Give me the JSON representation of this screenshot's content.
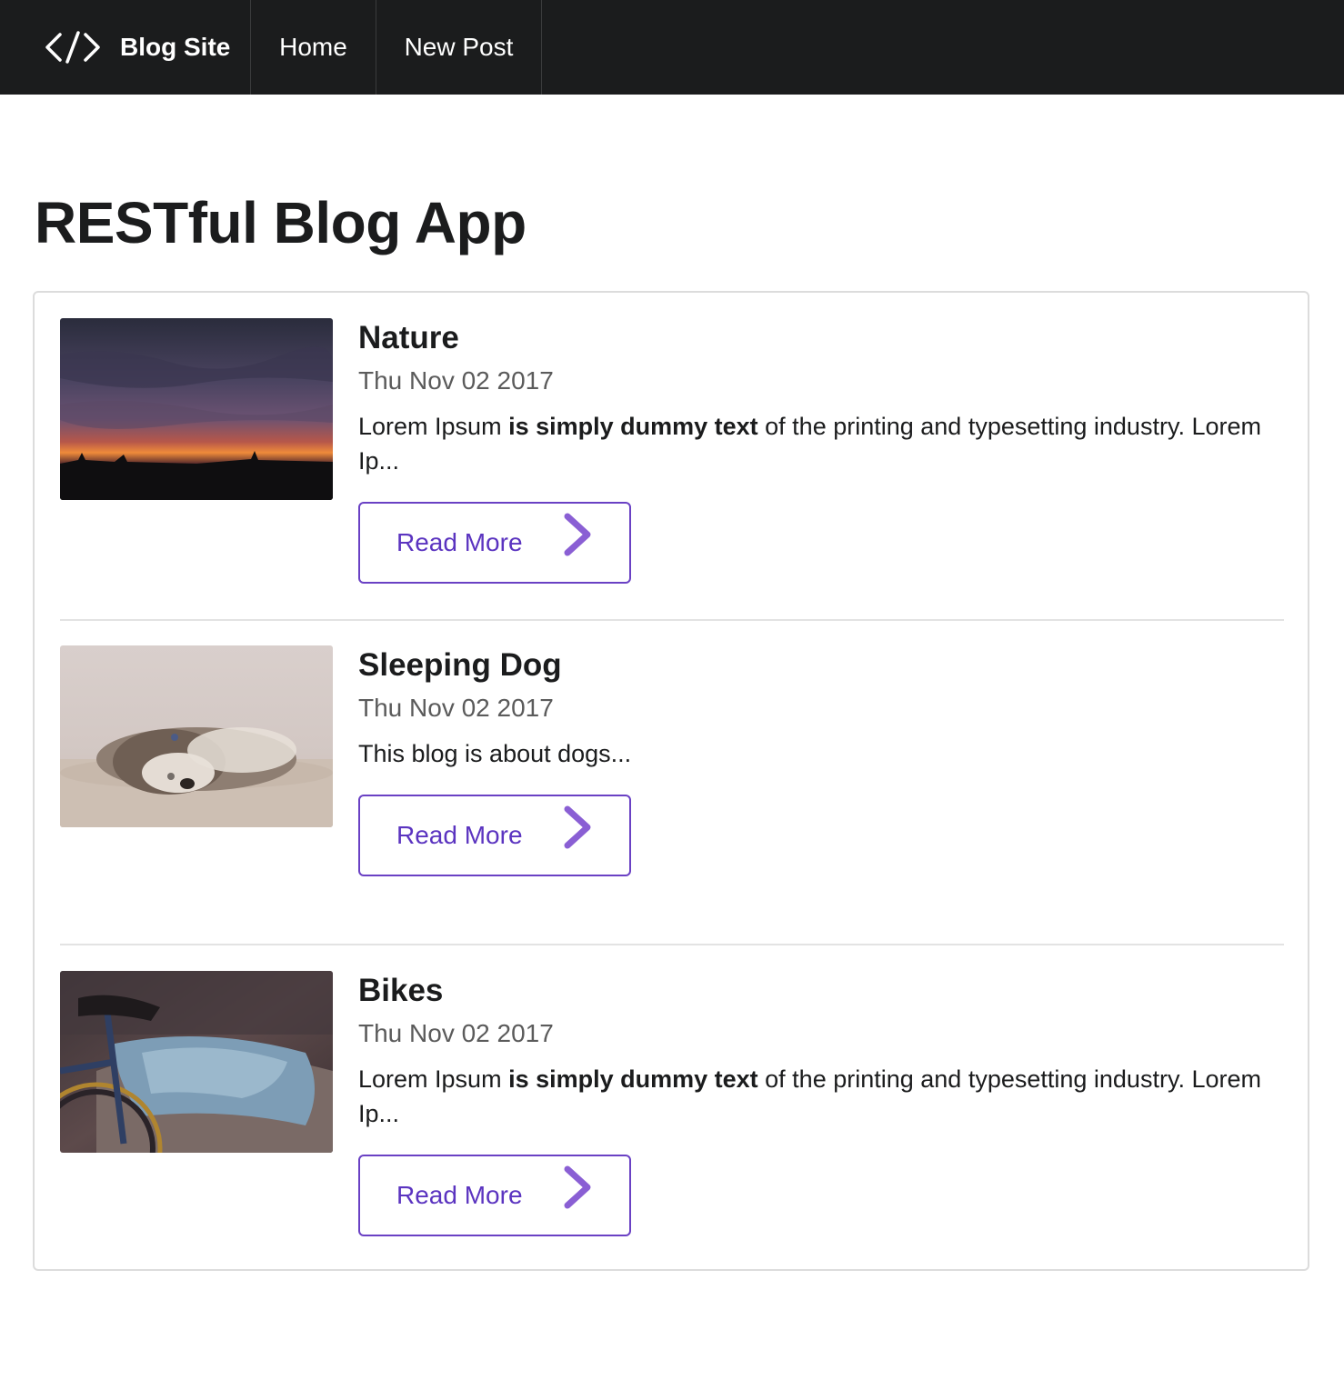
{
  "nav": {
    "brand": "Blog Site",
    "home": "Home",
    "new_post": "New Post",
    "brand_icon": "code-icon"
  },
  "page": {
    "title": "RESTful Blog App"
  },
  "posts": [
    {
      "title": "Nature",
      "date": "Thu Nov 02 2017",
      "desc_pre": "Lorem Ipsum ",
      "desc_bold": "is simply dummy text",
      "desc_post": " of the printing and typesetting industry. Lorem Ip...",
      "read_more": "Read More",
      "image": "sunset-landscape"
    },
    {
      "title": "Sleeping Dog",
      "date": "Thu Nov 02 2017",
      "desc_pre": "This blog is about dogs...",
      "desc_bold": "",
      "desc_post": "",
      "read_more": "Read More",
      "image": "sleeping-dog"
    },
    {
      "title": "Bikes",
      "date": "Thu Nov 02 2017",
      "desc_pre": "Lorem Ipsum ",
      "desc_bold": "is simply dummy text",
      "desc_post": " of the printing and typesetting industry. Lorem Ip...",
      "read_more": "Read More",
      "image": "bicycle-with-jacket"
    }
  ],
  "colors": {
    "nav_bg": "#1b1c1d",
    "accent": "#6a41c4",
    "text": "#1b1c1d",
    "meta": "#5b5b5b"
  }
}
